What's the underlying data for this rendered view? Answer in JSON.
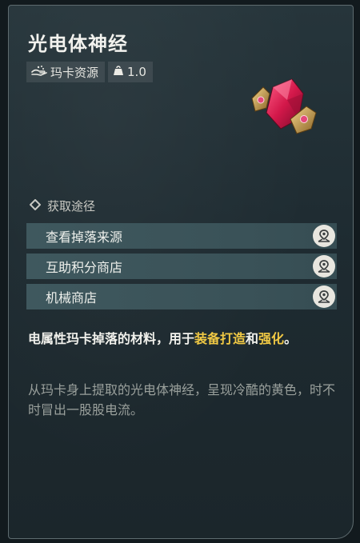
{
  "item": {
    "name": "光电体神经",
    "tags": [
      {
        "icon": "hand-gather-icon",
        "label": "玛卡资源"
      },
      {
        "icon": "weight-icon",
        "label": "1.0"
      }
    ],
    "image_icon": "crystal-gem-icon"
  },
  "acquisition": {
    "heading": "获取途径",
    "routes": [
      {
        "label": "查看掉落来源",
        "icon": "map-pin-icon"
      },
      {
        "label": "互助积分商店",
        "icon": "map-pin-icon"
      },
      {
        "label": "机械商店",
        "icon": "map-pin-icon"
      }
    ]
  },
  "description": {
    "part1": "电属性玛卡掉落的材料，用于",
    "highlight1": "装备打造",
    "part2": "和",
    "highlight2": "强化",
    "part3": "。"
  },
  "flavor": "从玛卡身上提取的光电体神经，呈现冷酷的黄色，时不时冒出一股股电流。",
  "colors": {
    "highlight": "#f1c944",
    "route_bg": "#3d565c",
    "card_bg": "#22303a"
  }
}
